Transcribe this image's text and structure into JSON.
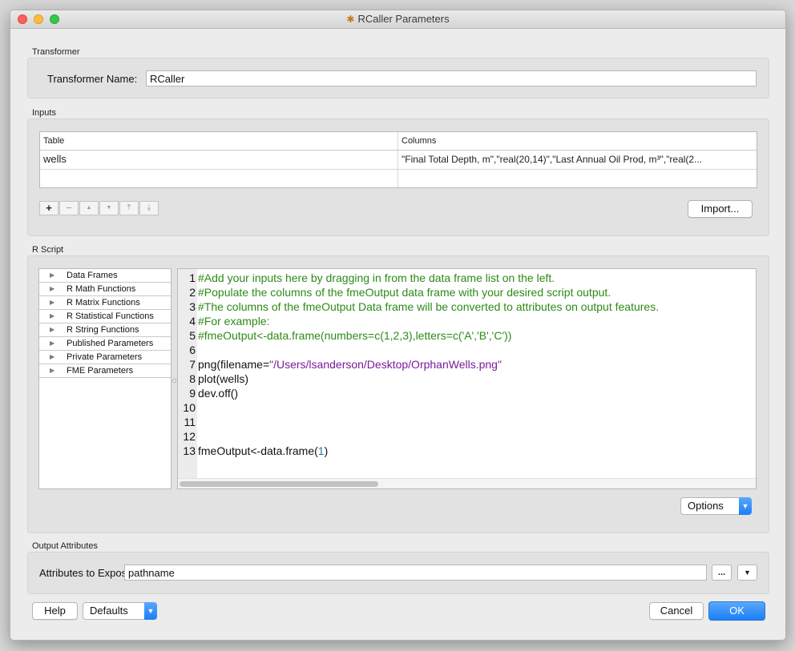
{
  "window": {
    "title": "RCaller Parameters"
  },
  "transformer": {
    "section_label": "Transformer",
    "name_label": "Transformer Name:",
    "name_value": "RCaller"
  },
  "inputs": {
    "section_label": "Inputs",
    "columns": [
      "Table",
      "Columns"
    ],
    "rows": [
      {
        "table": "wells",
        "columns": "\"Final Total Depth, m\",\"real(20,14)\",\"Last Annual Oil Prod, m³\",\"real(2..."
      },
      {
        "table": "",
        "columns": ""
      }
    ],
    "toolbar": {
      "add": "+",
      "remove": "−",
      "up": "▲",
      "down": "▼",
      "top": "⤒",
      "bottom": "⤓"
    },
    "import_label": "Import..."
  },
  "rscript": {
    "section_label": "R Script",
    "tree_items": [
      "Data Frames",
      "R Math Functions",
      "R Matrix Functions",
      "R Statistical Functions",
      "R String Functions",
      "Published Parameters",
      "Private Parameters",
      "FME Parameters"
    ],
    "lines": [
      {
        "n": "1",
        "parts": [
          {
            "t": "#Add your inputs here by dragging in from the data frame list on the left.",
            "c": "c-cmt"
          }
        ]
      },
      {
        "n": "2",
        "parts": [
          {
            "t": "#Populate the columns of the fmeOutput data frame with your desired script output.",
            "c": "c-cmt"
          }
        ]
      },
      {
        "n": "3",
        "parts": [
          {
            "t": "#The columns of the fmeOutput Data frame will be converted to attributes on output features.",
            "c": "c-cmt"
          }
        ]
      },
      {
        "n": "4",
        "parts": [
          {
            "t": "#For example:",
            "c": "c-cmt"
          }
        ]
      },
      {
        "n": "5",
        "parts": [
          {
            "t": "#fmeOutput<-data.frame(numbers=c(1,2,3),letters=c('A','B','C'))",
            "c": "c-cmt"
          }
        ]
      },
      {
        "n": "6",
        "parts": []
      },
      {
        "n": "7",
        "parts": [
          {
            "t": "png(filename=",
            "c": ""
          },
          {
            "t": "\"/Users/lsanderson/Desktop/OrphanWells.png\"",
            "c": "c-str"
          }
        ]
      },
      {
        "n": "8",
        "parts": [
          {
            "t": "plot(wells)",
            "c": ""
          }
        ]
      },
      {
        "n": "9",
        "parts": [
          {
            "t": "dev.off()",
            "c": ""
          }
        ]
      },
      {
        "n": "10",
        "parts": []
      },
      {
        "n": "11",
        "parts": []
      },
      {
        "n": "12",
        "parts": []
      },
      {
        "n": "13",
        "parts": [
          {
            "t": "fmeOutput<-data.frame(",
            "c": ""
          },
          {
            "t": "1",
            "c": "c-num"
          },
          {
            "t": ")",
            "c": ""
          }
        ]
      }
    ],
    "options_label": "Options"
  },
  "output": {
    "section_label": "Output Attributes",
    "expose_label": "Attributes to Expose:",
    "expose_value": "pathname",
    "ellipsis_label": "...",
    "menu_arrow": "▼"
  },
  "footer": {
    "help_label": "Help",
    "defaults_label": "Defaults",
    "cancel_label": "Cancel",
    "ok_label": "OK"
  }
}
